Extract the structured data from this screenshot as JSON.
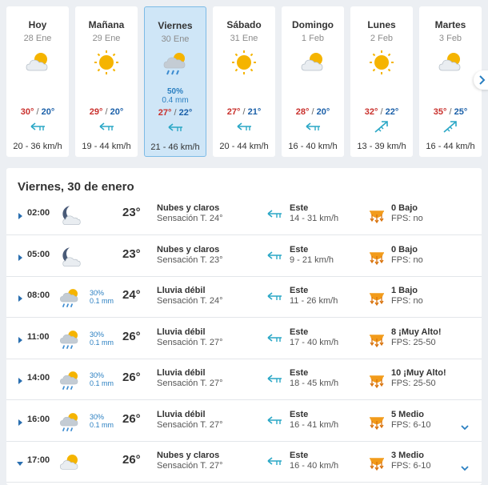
{
  "forecast": {
    "days": [
      {
        "name": "Hoy",
        "date": "28 Ene",
        "icon": "partly-cloudy-icon",
        "max": "30°",
        "min": "20°",
        "sep": " / ",
        "wind_icon": "wind-west-icon",
        "wind": "20 - 36 km/h",
        "selected": false,
        "rain_pct": "",
        "rain_mm": ""
      },
      {
        "name": "Mañana",
        "date": "29 Ene",
        "icon": "sun-icon",
        "max": "29°",
        "min": "20°",
        "sep": " / ",
        "wind_icon": "wind-west-icon",
        "wind": "19 - 44 km/h",
        "selected": false,
        "rain_pct": "",
        "rain_mm": ""
      },
      {
        "name": "Viernes",
        "date": "30 Ene",
        "icon": "sun-rain-icon",
        "max": "27°",
        "min": "22°",
        "sep": " / ",
        "wind_icon": "wind-west-icon",
        "wind": "21 - 46 km/h",
        "selected": true,
        "rain_pct": "50%",
        "rain_mm": "0.4 mm"
      },
      {
        "name": "Sábado",
        "date": "31 Ene",
        "icon": "sun-icon",
        "max": "27°",
        "min": "21°",
        "sep": " / ",
        "wind_icon": "wind-west-icon",
        "wind": "20 - 44 km/h",
        "selected": false,
        "rain_pct": "",
        "rain_mm": ""
      },
      {
        "name": "Domingo",
        "date": "1 Feb",
        "icon": "partly-cloudy-icon",
        "max": "28°",
        "min": "20°",
        "sep": " / ",
        "wind_icon": "wind-west-icon",
        "wind": "16 - 40 km/h",
        "selected": false,
        "rain_pct": "",
        "rain_mm": ""
      },
      {
        "name": "Lunes",
        "date": "2 Feb",
        "icon": "sun-icon",
        "max": "32°",
        "min": "22°",
        "sep": " / ",
        "wind_icon": "wind-northeast-icon",
        "wind": "13 - 39 km/h",
        "selected": false,
        "rain_pct": "",
        "rain_mm": ""
      },
      {
        "name": "Martes",
        "date": "3 Feb",
        "icon": "partly-cloudy-icon",
        "max": "35°",
        "min": "25°",
        "sep": " / ",
        "wind_icon": "wind-northeast-icon",
        "wind": "16 - 44 km/h",
        "selected": false,
        "rain_pct": "",
        "rain_mm": ""
      }
    ]
  },
  "hourly": {
    "title": "Viernes, 30 de enero",
    "rows": [
      {
        "time": "02:00",
        "icon": "moon-cloud-icon",
        "rain_pct": "",
        "rain_mm": "",
        "temp": "23°",
        "desc": "Nubes y claros",
        "feel": "Sensación T. 24°",
        "wind_dir": "Este",
        "wind_speed": "14 - 31 km/h",
        "uv": "0 Bajo",
        "fps": "FPS: no",
        "expanded": false,
        "expand_icon": false
      },
      {
        "time": "05:00",
        "icon": "moon-cloud-icon",
        "rain_pct": "",
        "rain_mm": "",
        "temp": "23°",
        "desc": "Nubes y claros",
        "feel": "Sensación T. 23°",
        "wind_dir": "Este",
        "wind_speed": "9 - 21 km/h",
        "uv": "0 Bajo",
        "fps": "FPS: no",
        "expanded": false,
        "expand_icon": false
      },
      {
        "time": "08:00",
        "icon": "sun-rain-icon",
        "rain_pct": "30%",
        "rain_mm": "0.1 mm",
        "temp": "24°",
        "desc": "Lluvia débil",
        "feel": "Sensación T. 24°",
        "wind_dir": "Este",
        "wind_speed": "11 - 26 km/h",
        "uv": "1 Bajo",
        "fps": "FPS: no",
        "expanded": false,
        "expand_icon": false
      },
      {
        "time": "11:00",
        "icon": "sun-rain-icon",
        "rain_pct": "30%",
        "rain_mm": "0.1 mm",
        "temp": "26°",
        "desc": "Lluvia débil",
        "feel": "Sensación T. 27°",
        "wind_dir": "Este",
        "wind_speed": "17 - 40 km/h",
        "uv": "8 ¡Muy Alto!",
        "fps": "FPS: 25-50",
        "expanded": false,
        "expand_icon": false
      },
      {
        "time": "14:00",
        "icon": "sun-rain-icon",
        "rain_pct": "30%",
        "rain_mm": "0.1 mm",
        "temp": "26°",
        "desc": "Lluvia débil",
        "feel": "Sensación T. 27°",
        "wind_dir": "Este",
        "wind_speed": "18 - 45 km/h",
        "uv": "10 ¡Muy Alto!",
        "fps": "FPS: 25-50",
        "expanded": false,
        "expand_icon": false
      },
      {
        "time": "16:00",
        "icon": "sun-rain-icon",
        "rain_pct": "30%",
        "rain_mm": "0.1 mm",
        "temp": "26°",
        "desc": "Lluvia débil",
        "feel": "Sensación T. 27°",
        "wind_dir": "Este",
        "wind_speed": "16 - 41 km/h",
        "uv": "5 Medio",
        "fps": "FPS: 6-10",
        "expanded": false,
        "expand_icon": true
      },
      {
        "time": "17:00",
        "icon": "partly-cloudy-icon",
        "rain_pct": "",
        "rain_mm": "",
        "temp": "26°",
        "desc": "Nubes y claros",
        "feel": "Sensación T. 27°",
        "wind_dir": "Este",
        "wind_speed": "16 - 40 km/h",
        "uv": "3 Medio",
        "fps": "FPS: 6-10",
        "expanded": true,
        "expand_icon": true
      }
    ]
  },
  "colors": {
    "max_temp": "#c9302c",
    "min_temp": "#1a5fa8",
    "accent": "#2a7fc1",
    "wind_icon": "#2aa7c6",
    "sun": "#f5b400"
  }
}
